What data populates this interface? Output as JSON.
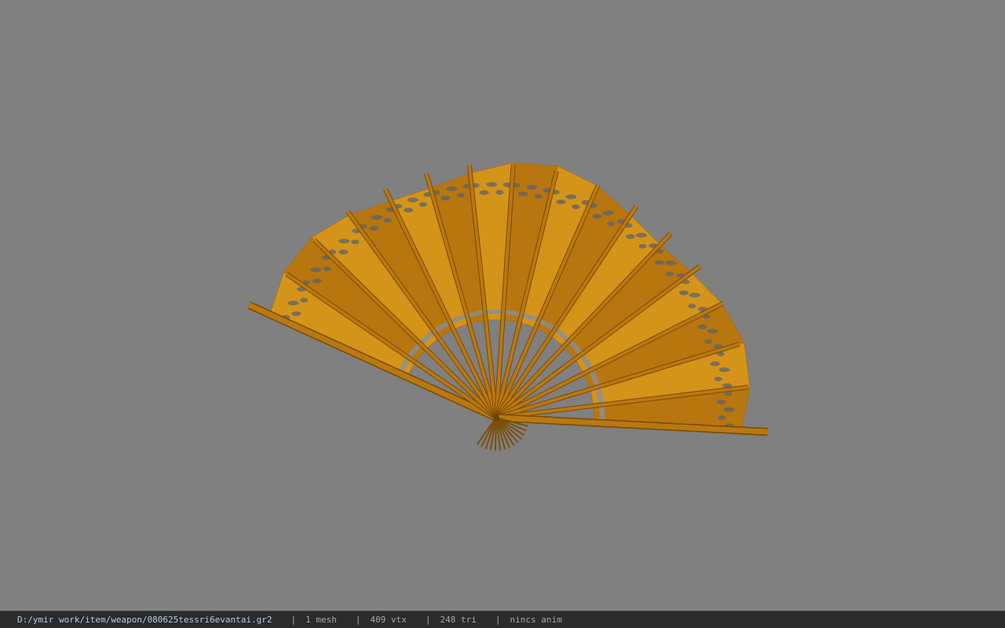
{
  "viewport": {
    "background_color": "#808080",
    "model": "folding-fan",
    "model_colors": {
      "paper": "#d4941a",
      "paper_dark": "#b8760f",
      "rib": "#b97812",
      "rib_edge": "#7a4a06",
      "pattern": "#5a6470"
    }
  },
  "status_bar": {
    "file_path": "D:/ymir work/item/weapon/080625tessri6evantai.gr2",
    "separator": "|",
    "mesh_count": "1 mesh",
    "vertex_count": "409 vtx",
    "triangle_count": "248 tri",
    "anim_status": "nincs anim",
    "path_color": "#a9d0e8",
    "text_color": "#a8a8a8"
  }
}
